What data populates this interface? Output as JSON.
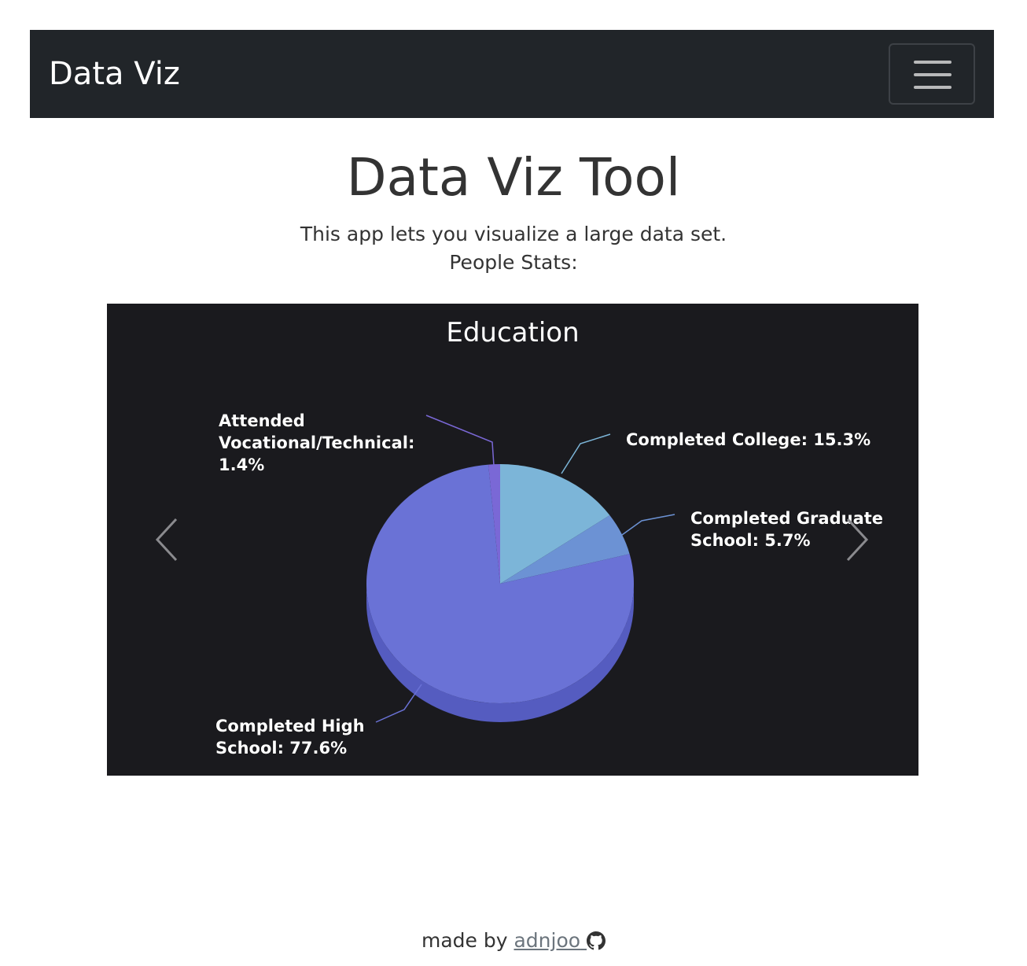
{
  "navbar": {
    "brand": "Data Viz"
  },
  "header": {
    "title": "Data Viz Tool",
    "description": "This app lets you visualize a large data set.",
    "subtitle": "People Stats:"
  },
  "chart_data": {
    "type": "pie",
    "title": "Education",
    "slices": [
      {
        "label": "Completed College",
        "value": 15.3,
        "color": "#7cb5d8",
        "label_lines": [
          "Completed College: 15.3%"
        ]
      },
      {
        "label": "Completed Graduate School",
        "value": 5.7,
        "color": "#6c92d4",
        "label_lines": [
          "Completed Graduate",
          "School: 5.7%"
        ]
      },
      {
        "label": "Completed High School",
        "value": 77.6,
        "color": "#6a72d6",
        "label_lines": [
          "Completed High",
          "School: 77.6%"
        ]
      },
      {
        "label": "Attended Vocational/Technical",
        "value": 1.4,
        "color": "#7a68d6",
        "label_lines": [
          "Attended",
          "Vocational/Technical:",
          "1.4%"
        ]
      }
    ],
    "style": "3d-pie",
    "background": "#1a1a1e"
  },
  "footer": {
    "prefix": "made by",
    "author": "adnjoo",
    "icon": "github-icon"
  }
}
